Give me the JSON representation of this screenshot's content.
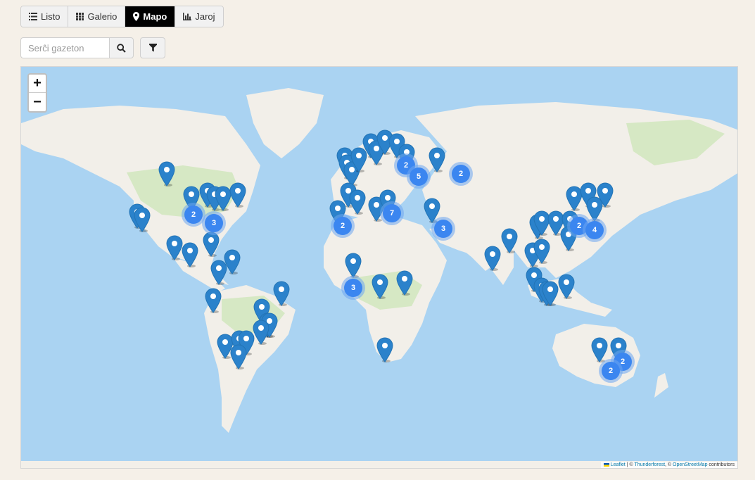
{
  "tabs": [
    {
      "label": "Listo",
      "icon": "list-icon"
    },
    {
      "label": "Galerio",
      "icon": "grid-icon"
    },
    {
      "label": "Mapo",
      "icon": "map-marker-icon",
      "active": true
    },
    {
      "label": "Jaroj",
      "icon": "bar-chart-icon"
    }
  ],
  "search": {
    "placeholder": "Serĉi gazeton"
  },
  "map": {
    "zoom_in": "+",
    "zoom_out": "−",
    "attribution": {
      "leaflet": "Leaflet",
      "thunderforest": "Thunderforest",
      "osm": "OpenStreetMap",
      "suffix": "contributors"
    },
    "colors": {
      "ocean": "#aad3f2",
      "land": "#f2efe9",
      "forest": "#d6e8c4",
      "marker": "#2b82cb",
      "cluster": "#3b86f0"
    },
    "clusters": [
      {
        "label": "2",
        "region": "north-america-west"
      },
      {
        "label": "3",
        "region": "north-america-east"
      },
      {
        "label": "2",
        "region": "iberia"
      },
      {
        "label": "7",
        "region": "italy"
      },
      {
        "label": "2",
        "region": "scandinavia"
      },
      {
        "label": "5",
        "region": "eastern-europe"
      },
      {
        "label": "2",
        "region": "russia"
      },
      {
        "label": "3",
        "region": "middle-east"
      },
      {
        "label": "3",
        "region": "west-africa"
      },
      {
        "label": "2",
        "region": "china"
      },
      {
        "label": "4",
        "region": "japan"
      },
      {
        "label": "2",
        "region": "australia-east"
      },
      {
        "label": "2",
        "region": "australia-southeast"
      }
    ]
  }
}
